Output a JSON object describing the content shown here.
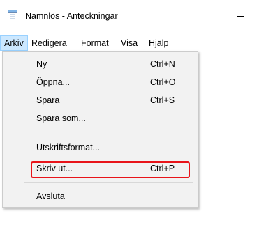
{
  "window": {
    "title": "Namnlös - Anteckningar"
  },
  "menubar": {
    "items": [
      {
        "label": "Arkiv"
      },
      {
        "label": "Redigera"
      },
      {
        "label": "Format"
      },
      {
        "label": "Visa"
      },
      {
        "label": "Hjälp"
      }
    ]
  },
  "file_menu": {
    "items": [
      {
        "label": "Ny",
        "shortcut": "Ctrl+N"
      },
      {
        "label": "Öppna...",
        "shortcut": "Ctrl+O"
      },
      {
        "label": "Spara",
        "shortcut": "Ctrl+S"
      },
      {
        "label": "Spara som...",
        "shortcut": ""
      },
      {
        "label": "Utskriftsformat...",
        "shortcut": ""
      },
      {
        "label": "Skriv ut...",
        "shortcut": "Ctrl+P"
      },
      {
        "label": "Avsluta",
        "shortcut": ""
      }
    ]
  },
  "colors": {
    "highlight": "#e8141a",
    "menu_active_bg": "#cce8ff",
    "dropdown_bg": "#f2f2f2"
  },
  "icons": {
    "app": "notepad-icon",
    "minimize": "minimize-icon"
  }
}
